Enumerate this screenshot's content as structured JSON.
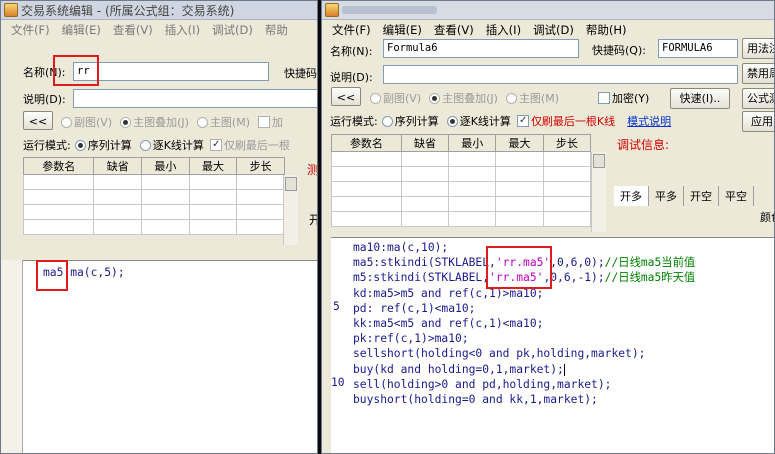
{
  "win1": {
    "title": "交易系统编辑 - (所属公式组：交易系统)",
    "menu": [
      "文件(F)",
      "编辑(E)",
      "查看(V)",
      "插入(I)",
      "调试(D)",
      "帮助"
    ],
    "name_label": "名称(N):",
    "name_value": "rr",
    "shortcut_label": "快捷码",
    "desc_label": "说明(D):",
    "chevron": "<<",
    "radio_sub": "副图(V)",
    "radio_main_overlay": "主图叠加(J)",
    "radio_main": "主图(M)",
    "radio_add_prefix": "加",
    "run_mode_label": "运行模式:",
    "run_seq": "序列计算",
    "run_kline": "逐K线计算",
    "only_last": "仅刷最后一根",
    "params_headers": [
      "参数名",
      "缺省",
      "最小",
      "最大",
      "步长"
    ],
    "side_red": "测",
    "side_black": "开",
    "code": [
      "ma5:ma(c,5);"
    ]
  },
  "win2": {
    "menu": [
      "文件(F)",
      "编辑(E)",
      "查看(V)",
      "插入(I)",
      "调试(D)",
      "帮助(H)"
    ],
    "name_label": "名称(N):",
    "name_value": "Formula6",
    "shortcut_label": "快捷码(Q):",
    "shortcut_value": "FORMULA6",
    "btn_usage": "用法注",
    "desc_label": "说明(D):",
    "btn_disable": "禁用周",
    "chevron": "<<",
    "radio_sub": "副图(V)",
    "radio_main_overlay": "主图叠加(J)",
    "radio_main": "主图(M)",
    "encrypt": "加密(Y)",
    "btn_quick": "快速(I)..",
    "btn_formula": "公式测",
    "run_mode_label": "运行模式:",
    "run_seq": "序列计算",
    "run_kline": "逐K线计算",
    "only_last": "仅刷最后一根K线",
    "mode_help": "模式说明",
    "btn_apply": "应用",
    "params_headers": [
      "参数名",
      "缺省",
      "最小",
      "最大",
      "步长"
    ],
    "debug_label": "调试信息:",
    "tabs": [
      "开多",
      "平多",
      "开空",
      "平空"
    ],
    "color_label": "颜色",
    "gutter": [
      "5",
      "10"
    ],
    "code": {
      "l1": "ma10:ma(c,10);",
      "l2a": "ma5:stkindi(STKLABEL,",
      "l2s": "'rr.ma5'",
      "l2b": ",0,6,0);",
      "l2c": "//日线ma5当前值",
      "l3a": "m5:stkindi(STKLABEL,",
      "l3s": "'rr.ma5'",
      "l3b": ",0,6,-1);",
      "l3c": "//日线ma5昨天值",
      "l4": "kd:ma5>m5 and ref(c,1)>ma10;",
      "l5": "pd: ref(c,1)<ma10;",
      "l6": "kk:ma5<m5 and ref(c,1)<ma10;",
      "l7": "pk:ref(c,1)>ma10;",
      "l8": "sellshort(holding<0 and pk,holding,market);",
      "l9": "buy(kd and holding=0,1,market);",
      "l10": "sell(holding>0 and pd,holding,market);",
      "l11": "buyshort(holding=0 and kk,1,market);"
    }
  },
  "colors": {
    "highlight": "#e01b1b",
    "code": "#1a1a8c",
    "string": "#c000c0",
    "comment": "#008000"
  }
}
